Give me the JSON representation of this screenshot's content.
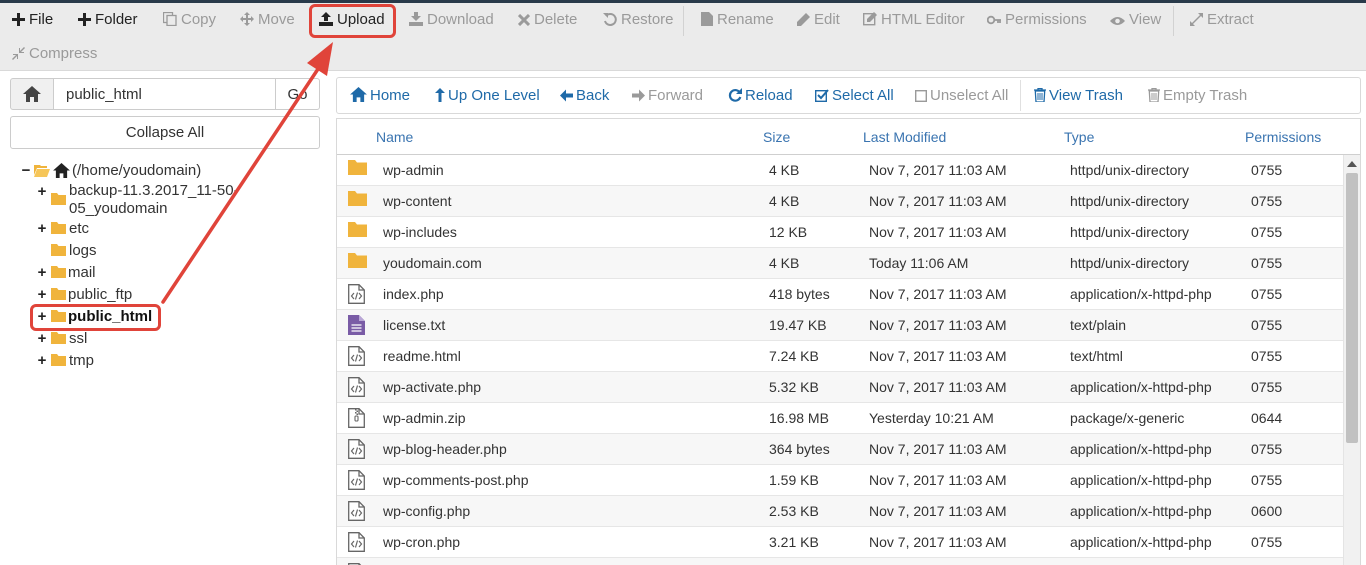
{
  "toolbar": {
    "items": [
      {
        "label": "File",
        "icon": "plus-icon",
        "enabled": true
      },
      {
        "label": "Folder",
        "icon": "plus-icon",
        "enabled": true
      },
      {
        "label": "Copy",
        "icon": "copy-icon",
        "enabled": false
      },
      {
        "label": "Move",
        "icon": "move-icon",
        "enabled": false
      },
      {
        "label": "Upload",
        "icon": "upload-icon",
        "enabled": true
      },
      {
        "label": "Download",
        "icon": "download-icon",
        "enabled": false
      },
      {
        "label": "Delete",
        "icon": "delete-icon",
        "enabled": false
      },
      {
        "label": "Restore",
        "icon": "restore-icon",
        "enabled": false
      },
      {
        "label": "Rename",
        "icon": "rename-icon",
        "enabled": false
      },
      {
        "label": "Edit",
        "icon": "edit-icon",
        "enabled": false
      },
      {
        "label": "HTML Editor",
        "icon": "html-editor-icon",
        "enabled": false
      },
      {
        "label": "Permissions",
        "icon": "key-icon",
        "enabled": false
      },
      {
        "label": "View",
        "icon": "eye-icon",
        "enabled": false
      },
      {
        "label": "Extract",
        "icon": "extract-icon",
        "enabled": false
      },
      {
        "label": "Compress",
        "icon": "compress-icon",
        "enabled": false
      }
    ]
  },
  "sidebar": {
    "path_value": "public_html",
    "go_label": "Go",
    "collapse_label": "Collapse All",
    "tree": [
      {
        "label": "(/home/youdomain)",
        "toggle": "−",
        "type": "root"
      },
      {
        "label": "backup-11.3.2017_11-50-",
        "label2": "05_youdomain",
        "toggle": "+",
        "type": "folder"
      },
      {
        "label": "etc",
        "toggle": "+",
        "type": "folder"
      },
      {
        "label": "logs",
        "toggle": "",
        "type": "folder"
      },
      {
        "label": "mail",
        "toggle": "+",
        "type": "folder"
      },
      {
        "label": "public_ftp",
        "toggle": "+",
        "type": "folder"
      },
      {
        "label": "public_html",
        "toggle": "+",
        "type": "folder",
        "selected": true
      },
      {
        "label": "ssl",
        "toggle": "+",
        "type": "folder"
      },
      {
        "label": "tmp",
        "toggle": "+",
        "type": "folder"
      }
    ]
  },
  "nav": {
    "items": [
      {
        "label": "Home",
        "icon": "home-icon",
        "enabled": true
      },
      {
        "label": "Up One Level",
        "icon": "up-arrow-icon",
        "enabled": true
      },
      {
        "label": "Back",
        "icon": "back-arrow-icon",
        "enabled": true
      },
      {
        "label": "Forward",
        "icon": "forward-arrow-icon",
        "enabled": false
      },
      {
        "label": "Reload",
        "icon": "reload-icon",
        "enabled": true
      },
      {
        "label": "Select All",
        "icon": "checked-box-icon",
        "enabled": true
      },
      {
        "label": "Unselect All",
        "icon": "empty-box-icon",
        "enabled": false
      },
      {
        "label": "View Trash",
        "icon": "trash-icon",
        "enabled": true
      },
      {
        "label": "Empty Trash",
        "icon": "trash-icon",
        "enabled": false
      }
    ]
  },
  "table": {
    "columns": [
      "Name",
      "Size",
      "Last Modified",
      "Type",
      "Permissions"
    ],
    "rows": [
      {
        "icon": "folder-icon",
        "name": "wp-admin",
        "size": "4 KB",
        "modified": "Nov 7, 2017 11:03 AM",
        "type": "httpd/unix-directory",
        "perms": "0755"
      },
      {
        "icon": "folder-icon",
        "name": "wp-content",
        "size": "4 KB",
        "modified": "Nov 7, 2017 11:03 AM",
        "type": "httpd/unix-directory",
        "perms": "0755"
      },
      {
        "icon": "folder-icon",
        "name": "wp-includes",
        "size": "12 KB",
        "modified": "Nov 7, 2017 11:03 AM",
        "type": "httpd/unix-directory",
        "perms": "0755"
      },
      {
        "icon": "folder-icon",
        "name": "youdomain.com",
        "size": "4 KB",
        "modified": "Today 11:06 AM",
        "type": "httpd/unix-directory",
        "perms": "0755"
      },
      {
        "icon": "code-file-icon",
        "name": "index.php",
        "size": "418 bytes",
        "modified": "Nov 7, 2017 11:03 AM",
        "type": "application/x-httpd-php",
        "perms": "0755"
      },
      {
        "icon": "text-file-icon",
        "name": "license.txt",
        "size": "19.47 KB",
        "modified": "Nov 7, 2017 11:03 AM",
        "type": "text/plain",
        "perms": "0755"
      },
      {
        "icon": "code-file-icon",
        "name": "readme.html",
        "size": "7.24 KB",
        "modified": "Nov 7, 2017 11:03 AM",
        "type": "text/html",
        "perms": "0755"
      },
      {
        "icon": "code-file-icon",
        "name": "wp-activate.php",
        "size": "5.32 KB",
        "modified": "Nov 7, 2017 11:03 AM",
        "type": "application/x-httpd-php",
        "perms": "0755"
      },
      {
        "icon": "zip-file-icon",
        "name": "wp-admin.zip",
        "size": "16.98 MB",
        "modified": "Yesterday 10:21 AM",
        "type": "package/x-generic",
        "perms": "0644"
      },
      {
        "icon": "code-file-icon",
        "name": "wp-blog-header.php",
        "size": "364 bytes",
        "modified": "Nov 7, 2017 11:03 AM",
        "type": "application/x-httpd-php",
        "perms": "0755"
      },
      {
        "icon": "code-file-icon",
        "name": "wp-comments-post.php",
        "size": "1.59 KB",
        "modified": "Nov 7, 2017 11:03 AM",
        "type": "application/x-httpd-php",
        "perms": "0755"
      },
      {
        "icon": "code-file-icon",
        "name": "wp-config.php",
        "size": "2.53 KB",
        "modified": "Nov 7, 2017 11:03 AM",
        "type": "application/x-httpd-php",
        "perms": "0600"
      },
      {
        "icon": "code-file-icon",
        "name": "wp-cron.php",
        "size": "3.21 KB",
        "modified": "Nov 7, 2017 11:03 AM",
        "type": "application/x-httpd-php",
        "perms": "0755"
      },
      {
        "icon": "code-file-icon",
        "name": "",
        "size": "",
        "modified": "",
        "type": "",
        "perms": ""
      }
    ]
  },
  "colors": {
    "accent": "#1f6aa8",
    "header_text": "#3a74b0",
    "folder": "#f0b43c",
    "highlight": "#e0443a",
    "disabled": "#9a9a9a"
  }
}
